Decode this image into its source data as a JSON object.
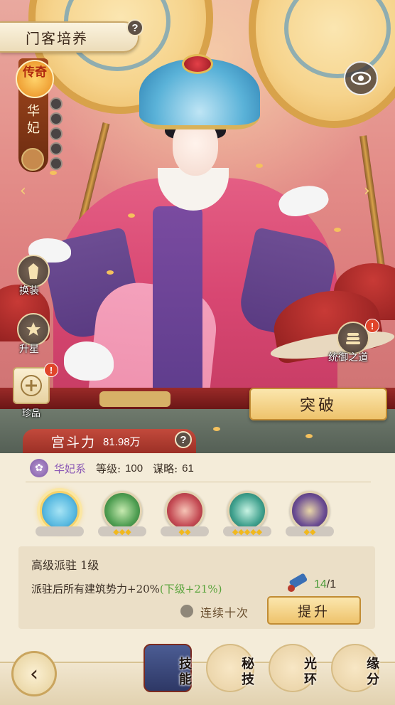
{
  "header": {
    "title": "门客培养"
  },
  "character": {
    "rarity": "传奇",
    "name": "华妃"
  },
  "side_buttons": {
    "outfit": "换装",
    "star_up": "升星",
    "treasure": "珍品",
    "rule": "统御之道"
  },
  "badges": {
    "treasure": "!",
    "rule": "!"
  },
  "actions": {
    "breakthrough": "突破"
  },
  "power": {
    "label": "宫斗力",
    "value": "81.98万"
  },
  "faction": {
    "name": "华妃系",
    "level_label": "等级:",
    "level": "100",
    "strategy_label": "谋略:",
    "strategy": "61"
  },
  "skills": [
    {
      "name": "skill-1",
      "stars": "",
      "color": "#58b9e0",
      "active": true
    },
    {
      "name": "skill-2",
      "stars": "◆◆◆",
      "color": "#4f9e52"
    },
    {
      "name": "skill-3",
      "stars": "◆◆",
      "color": "#c44b54"
    },
    {
      "name": "skill-4",
      "stars": "◆◆◆◆◆",
      "color": "#3fa08d"
    },
    {
      "name": "skill-5",
      "stars": "◆◆",
      "color": "#6b4d93"
    }
  ],
  "detail": {
    "title": "高级派驻 1级",
    "desc": "派驻后所有建筑势力+20%",
    "next": "(下级+21%)",
    "have": "14",
    "need": "/1",
    "ten_times": "连续十次",
    "upgrade": "提升"
  },
  "nav": {
    "back": "‹",
    "items": [
      {
        "label": "技能"
      },
      {
        "label": "秘技"
      },
      {
        "label": "光环"
      },
      {
        "label": "缘分"
      }
    ]
  },
  "colors": {
    "accent": "#c24a3c",
    "gold": "#eec36c",
    "panel": "#f4ecd9"
  }
}
